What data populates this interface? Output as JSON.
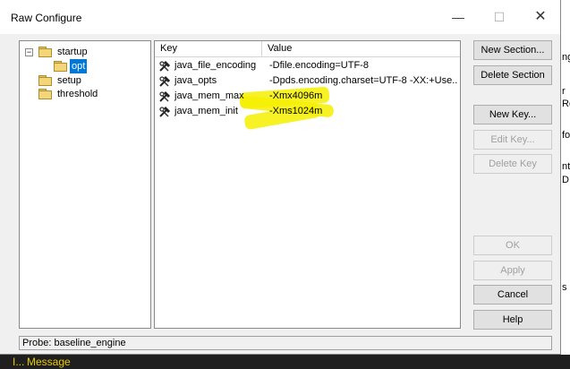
{
  "window": {
    "title": "Raw Configure",
    "controls": {
      "minimize": "—",
      "maximize": "☐",
      "close": "✕"
    }
  },
  "tree": {
    "nodes": [
      {
        "label": "startup",
        "expander": "−"
      },
      {
        "label": "opt",
        "selected": true
      },
      {
        "label": "setup"
      },
      {
        "label": "threshold"
      }
    ]
  },
  "list": {
    "columns": [
      "Key",
      "Value"
    ],
    "rows": [
      {
        "key": "java_file_encoding",
        "value": "-Dfile.encoding=UTF-8",
        "highlighted": false
      },
      {
        "key": "java_opts",
        "value": "-Dpds.encoding.charset=UTF-8 -XX:+Use...",
        "highlighted": false
      },
      {
        "key": "java_mem_max",
        "value": "-Xmx4096m",
        "highlighted": true
      },
      {
        "key": "java_mem_init",
        "value": "-Xms1024m",
        "highlighted": true
      }
    ],
    "row_icon": "tool-wrench-hammer-icon"
  },
  "buttons": {
    "new_section": "New Section...",
    "delete_section": "Delete Section",
    "new_key": "New Key...",
    "edit_key": "Edit Key...",
    "delete_key": "Delete Key",
    "ok": "OK",
    "apply": "Apply",
    "cancel": "Cancel",
    "help": "Help"
  },
  "disabled_buttons": [
    "edit_key",
    "delete_key",
    "ok",
    "apply"
  ],
  "status": "Probe: baseline_engine",
  "background": {
    "bottom_text": "Message",
    "bottom_marker": "I...",
    "right_letters": [
      "ng",
      "r",
      "Ro",
      "fo",
      "nt",
      "D",
      "s"
    ]
  },
  "colors": {
    "selection": "#0078d7",
    "highlight": "#f5f000",
    "bottom_text": "#e8c800"
  }
}
